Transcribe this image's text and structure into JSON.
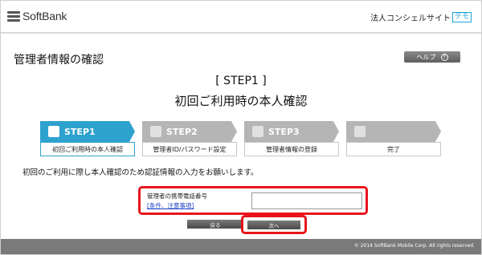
{
  "header": {
    "logo_text": "SoftBank",
    "service_name": "法人コンシェルサイト",
    "demo_badge": "デモ"
  },
  "page": {
    "title": "管理者情報の確認",
    "help_label": "ヘルプ",
    "step_heading": "[ STEP1 ]",
    "step_subheading": "初回ご利用時の本人確認"
  },
  "stepper": [
    {
      "label": "STEP1",
      "caption": "初回ご利用時の本人確認",
      "active": true,
      "icon": "step1-icon"
    },
    {
      "label": "STEP2",
      "caption": "管理者ID/パスワード設定",
      "active": false,
      "icon": "key-icon"
    },
    {
      "label": "STEP3",
      "caption": "管理者情報の登録",
      "active": false,
      "icon": "user-icon"
    },
    {
      "label": "",
      "caption": "完了",
      "active": false,
      "icon": "checkered-flag-icon"
    }
  ],
  "instruction": "初回のご利用に際し本人確認のため認証情報の入力をお願いします。",
  "form": {
    "phone_label": "管理者の携帯電話番号",
    "terms_link": "[条件、注意事項]",
    "phone_value": ""
  },
  "buttons": {
    "back": "戻る",
    "next": "次へ"
  },
  "footer": {
    "copyright": "© 2014 SoftBank Mobile Corp. All rights reserved."
  },
  "colors": {
    "accent": "#2ea2cf",
    "highlight_red": "#e8141b",
    "footer_gray": "#7a7a7a"
  }
}
